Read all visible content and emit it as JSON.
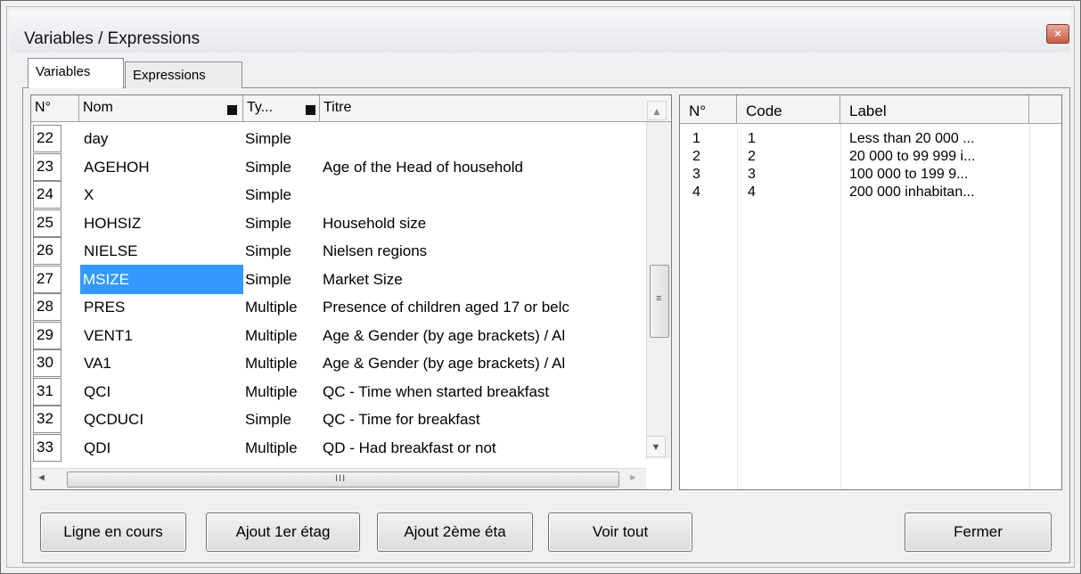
{
  "window": {
    "title": "Variables / Expressions",
    "close_glyph": "×"
  },
  "tabs": [
    {
      "label": "Variables",
      "active": true
    },
    {
      "label": "Expressions",
      "active": false
    }
  ],
  "variables_grid": {
    "headers": {
      "num": "N°",
      "nom": "Nom",
      "type": "Ty...",
      "titre": "Titre"
    },
    "rows": [
      {
        "num": "22",
        "nom": "day",
        "type": "Simple",
        "titre": ""
      },
      {
        "num": "23",
        "nom": "AGEHOH",
        "type": "Simple",
        "titre": "Age of the Head of household"
      },
      {
        "num": "24",
        "nom": "X",
        "type": "Simple",
        "titre": ""
      },
      {
        "num": "25",
        "nom": "HOHSIZ",
        "type": "Simple",
        "titre": "Household size"
      },
      {
        "num": "26",
        "nom": "NIELSE",
        "type": "Simple",
        "titre": "Nielsen regions"
      },
      {
        "num": "27",
        "nom": "MSIZE",
        "type": "Simple",
        "titre": "Market Size",
        "selected": true
      },
      {
        "num": "28",
        "nom": "PRES",
        "type": "Multiple",
        "titre": "Presence of children aged 17 or belc"
      },
      {
        "num": "29",
        "nom": "VENT1",
        "type": "Multiple",
        "titre": "Age & Gender (by age brackets) / Al"
      },
      {
        "num": "30",
        "nom": "VA1",
        "type": "Multiple",
        "titre": "Age & Gender (by age brackets) / Al"
      },
      {
        "num": "31",
        "nom": "QCI",
        "type": "Multiple",
        "titre": "QC - Time when started breakfast"
      },
      {
        "num": "32",
        "nom": "QCDUCI",
        "type": "Simple",
        "titre": "QC - Time for breakfast"
      },
      {
        "num": "33",
        "nom": "QDI",
        "type": "Multiple",
        "titre": "QD - Had breakfast or not"
      }
    ],
    "scroll_glyphs": {
      "up": "▲",
      "down": "▼",
      "left": "◄",
      "right": "►",
      "grip_v": "≡",
      "grip_h": "III"
    }
  },
  "codes_grid": {
    "headers": {
      "num": "N°",
      "code": "Code",
      "label": "Label"
    },
    "rows": [
      {
        "num": "1",
        "code": "1",
        "label": "Less than 20 000 ..."
      },
      {
        "num": "2",
        "code": "2",
        "label": "20 000 to 99 999 i..."
      },
      {
        "num": "3",
        "code": "3",
        "label": "100 000 to 199 9..."
      },
      {
        "num": "4",
        "code": "4",
        "label": "200 000 inhabitan..."
      }
    ]
  },
  "buttons": {
    "ligne": "Ligne en cours",
    "ajout1": "Ajout 1er étag",
    "ajout2": "Ajout 2ème éta",
    "voir": "Voir tout",
    "fermer": "Fermer"
  },
  "colors": {
    "selection": "#3399ff",
    "close_button": "#c75a45"
  }
}
